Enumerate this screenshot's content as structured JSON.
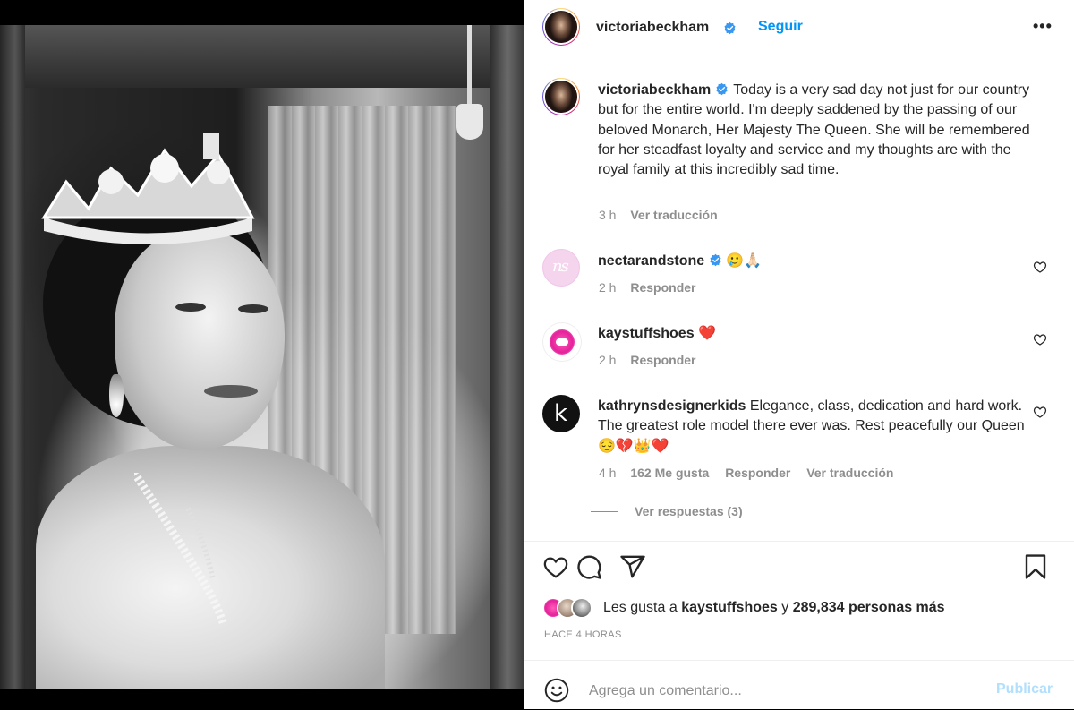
{
  "post": {
    "author": "victoriabeckham",
    "follow_label": "Seguir",
    "more_label": "•••",
    "verified_icon": "verified-badge-icon",
    "caption": {
      "username": "victoriabeckham",
      "text": "Today is a very sad day not just for our country but for the entire world. I'm deeply saddened by the passing of our beloved Monarch, Her Majesty The Queen. She will be remembered for her steadfast loyalty and service and my thoughts are with the royal family at this incredibly sad time.",
      "time": "3 h",
      "translate_label": "Ver traducción"
    }
  },
  "comments": [
    {
      "username": "nectarandstone",
      "verified": true,
      "text": "🥲🙏🏻",
      "time": "2 h",
      "reply_label": "Responder",
      "avatar_text": "ns"
    },
    {
      "username": "kaystuffshoes",
      "verified": false,
      "text": "❤️",
      "time": "2 h",
      "reply_label": "Responder"
    },
    {
      "username": "kathrynsdesignerkids",
      "verified": false,
      "text": "Elegance, class, dedication and hard work. The greatest role model there ever was. Rest peacefully our Queen 😔💔👑❤️",
      "time": "4 h",
      "likes": "162 Me gusta",
      "reply_label": "Responder",
      "translate_label": "Ver traducción",
      "avatar_text": "k",
      "view_replies": "Ver respuestas (3)"
    }
  ],
  "likes": {
    "prefix": "Les gusta a",
    "user": "kaystuffshoes",
    "conj": "y",
    "others": "289,834 personas más"
  },
  "time_ago": "HACE 4 HORAS",
  "composer": {
    "placeholder": "Agrega un comentario...",
    "publish_label": "Publicar"
  },
  "colors": {
    "link_blue": "#0095f6",
    "publish_disabled": "#b2dffc",
    "secondary_text": "#8e8e8e",
    "primary_text": "#262626",
    "heart_red": "#ed4956"
  }
}
